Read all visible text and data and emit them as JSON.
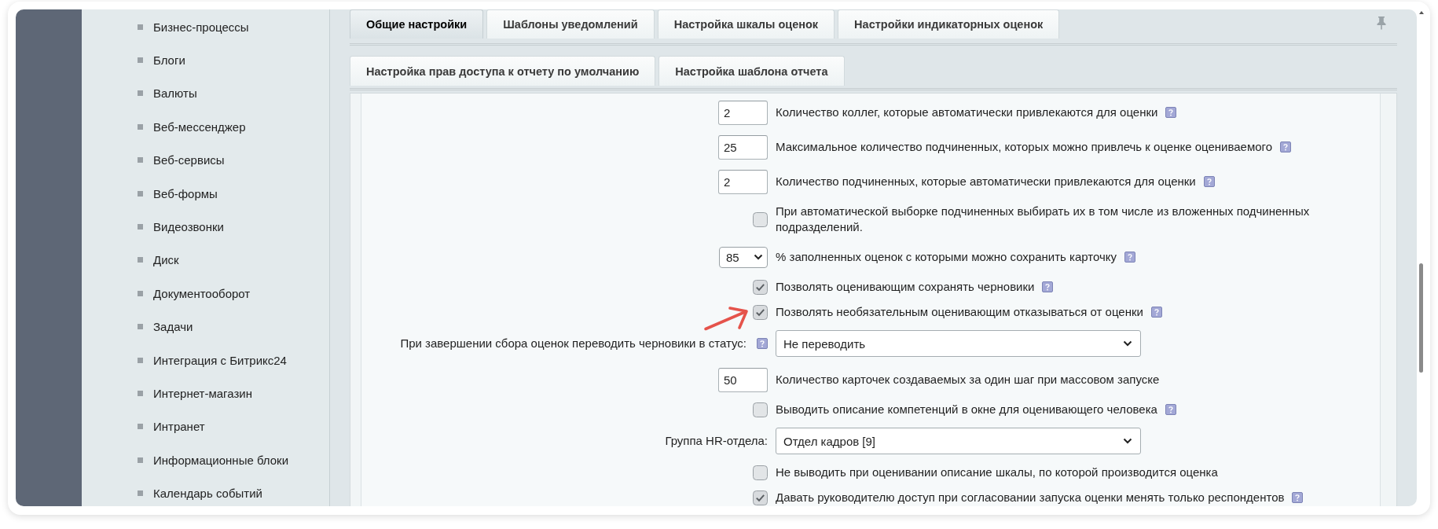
{
  "sidebar": {
    "items": [
      {
        "label": "Бизнес-процессы"
      },
      {
        "label": "Блоги"
      },
      {
        "label": "Валюты"
      },
      {
        "label": "Веб-мессенджер"
      },
      {
        "label": "Веб-сервисы"
      },
      {
        "label": "Веб-формы"
      },
      {
        "label": "Видеозвонки"
      },
      {
        "label": "Диск"
      },
      {
        "label": "Документооборот"
      },
      {
        "label": "Задачи"
      },
      {
        "label": "Интеграция с Битрикс24"
      },
      {
        "label": "Интернет-магазин"
      },
      {
        "label": "Интранет"
      },
      {
        "label": "Информационные блоки"
      },
      {
        "label": "Календарь событий"
      }
    ]
  },
  "tab_rows": [
    {
      "tabs": [
        {
          "label": "Общие настройки",
          "selected": true
        },
        {
          "label": "Шаблоны уведомлений",
          "selected": false
        },
        {
          "label": "Настройка шкалы оценок",
          "selected": false
        },
        {
          "label": "Настройки индикаторных оценок",
          "selected": false
        }
      ]
    },
    {
      "tabs": [
        {
          "label": "Настройка прав доступа к отчету по умолчанию",
          "selected": false
        },
        {
          "label": "Настройка шаблона отчета",
          "selected": false
        }
      ]
    }
  ],
  "settings": [
    {
      "kind": "number",
      "value": "2",
      "label": "Количество коллег, которые автоматически привлекаются для оценки",
      "help": true,
      "annotated": false
    },
    {
      "kind": "number",
      "value": "25",
      "label": "Максимальное количество подчиненных, которых можно привлечь к оценке оцениваемого",
      "help": true,
      "annotated": false
    },
    {
      "kind": "number",
      "value": "2",
      "label": "Количество подчиненных, которые автоматически привлекаются для оценки",
      "help": true,
      "annotated": false
    },
    {
      "kind": "checkbox",
      "checked": false,
      "label": "При автоматической выборке подчиненных выбирать их в том числе из вложенных подчиненных подразделений.",
      "help": false,
      "annotated": false
    },
    {
      "kind": "percent",
      "value": "85",
      "label": "% заполненных оценок с которыми можно сохранить карточку",
      "help": true,
      "annotated": false
    },
    {
      "kind": "checkbox",
      "checked": true,
      "label": "Позволять оценивающим сохранять черновики",
      "help": true,
      "annotated": false
    },
    {
      "kind": "checkbox",
      "checked": true,
      "label": "Позволять необязательным оценивающим отказываться от оценки",
      "help": true,
      "annotated": true
    },
    {
      "kind": "select",
      "prompt": "При завершении сбора оценок переводить черновики в статус:",
      "help": true,
      "value": "Не переводить",
      "annotated": false
    },
    {
      "kind": "number",
      "value": "50",
      "label": "Количество карточек создаваемых за один шаг при массовом запуске",
      "help": false,
      "annotated": false
    },
    {
      "kind": "checkbox",
      "checked": false,
      "label": "Выводить описание компетенций в окне для оценивающего человека",
      "help": true,
      "annotated": false
    },
    {
      "kind": "select",
      "prompt": "Группа HR-отдела:",
      "help": false,
      "value": "Отдел кадров [9]",
      "annotated": false
    },
    {
      "kind": "checkbox",
      "checked": false,
      "label": "Не выводить при оценивании описание шкалы, по которой производится оценка",
      "help": false,
      "annotated": false
    },
    {
      "kind": "checkbox",
      "checked": true,
      "label": "Давать руководителю доступ при согласовании запуска оценки менять только респондентов",
      "help": true,
      "annotated": false
    }
  ]
}
